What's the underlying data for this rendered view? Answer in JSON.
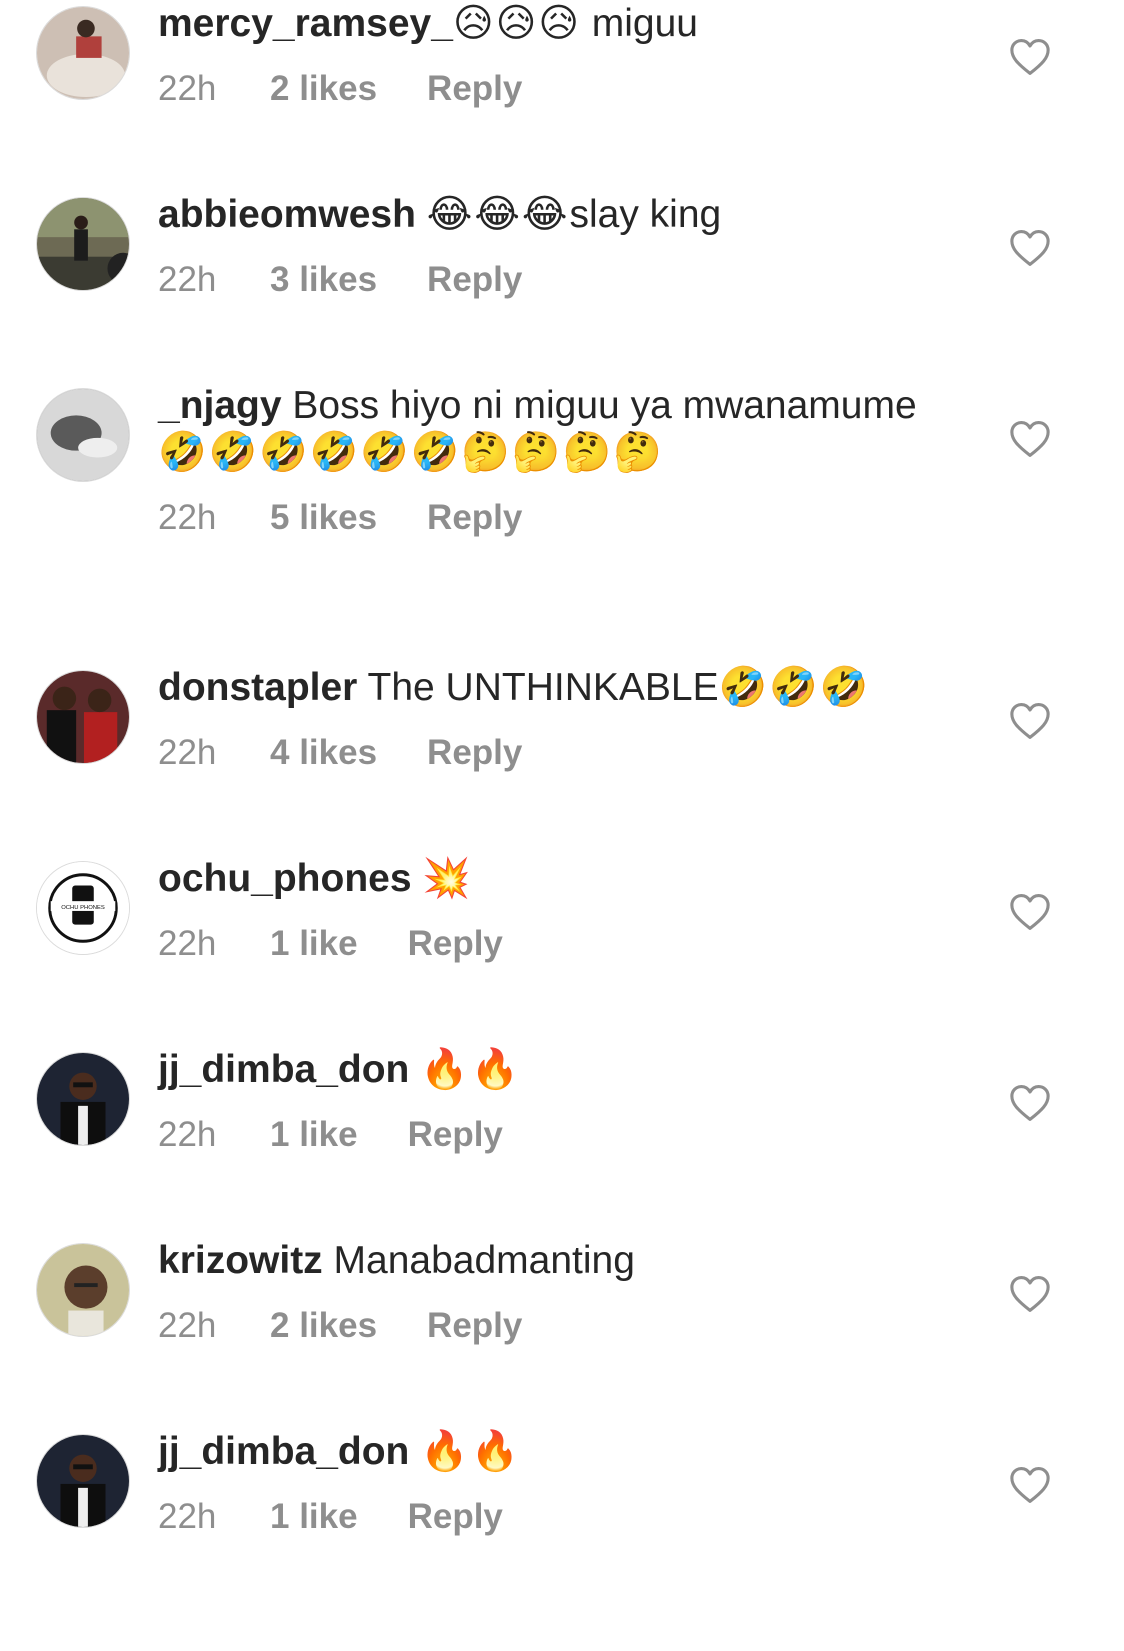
{
  "comments": [
    {
      "username": "mercy_ramsey_",
      "message": "",
      "emojis": "😥😥😥",
      "after": "  miguu",
      "time": "22h",
      "likes": "2 likes",
      "reply": "Reply",
      "avatar_color": "#cdbfb4"
    },
    {
      "username": "abbieomwesh",
      "message": "",
      "emojis": "😂😂😂",
      "after": "slay king",
      "time": "22h",
      "likes": "3 likes",
      "reply": "Reply",
      "avatar_color": "#6d6a54"
    },
    {
      "username": "_njagy",
      "message": " Boss hiyo ni miguu ya mwanamume ",
      "emojis": "🤣🤣🤣🤣🤣🤣🤔🤔🤔🤔",
      "after": "",
      "time": "22h",
      "likes": "5 likes",
      "reply": "Reply",
      "avatar_color": "#8a8a8a"
    },
    {
      "username": "donstapler",
      "message": " The UNTHINKABLE",
      "emojis": "🤣🤣🤣",
      "after": "",
      "time": "22h",
      "likes": "4 likes",
      "reply": "Reply",
      "avatar_color": "#5a2a2a"
    },
    {
      "username": "ochu_phones",
      "message": " ",
      "emojis": "💥",
      "after": "",
      "time": "22h",
      "likes": "1 like",
      "reply": "Reply",
      "avatar_color": "#ffffff"
    },
    {
      "username": "jj_dimba_don",
      "message": " ",
      "emojis": "🔥🔥",
      "after": "",
      "time": "22h",
      "likes": "1 like",
      "reply": "Reply",
      "avatar_color": "#1e2433"
    },
    {
      "username": "krizowitz",
      "message": " Manabadmanting",
      "emojis": "",
      "after": "",
      "time": "22h",
      "likes": "2 likes",
      "reply": "Reply",
      "avatar_color": "#c9c39a"
    },
    {
      "username": "jj_dimba_don",
      "message": " ",
      "emojis": "🔥🔥",
      "after": "",
      "time": "22h",
      "likes": "1 like",
      "reply": "Reply",
      "avatar_color": "#1e2433"
    }
  ],
  "avatar_logo_text": "OCHU PHONES",
  "icons": {
    "like": "heart-outline-icon"
  },
  "colors": {
    "text": "#262626",
    "meta": "#8e8e8e",
    "background": "#ffffff"
  }
}
